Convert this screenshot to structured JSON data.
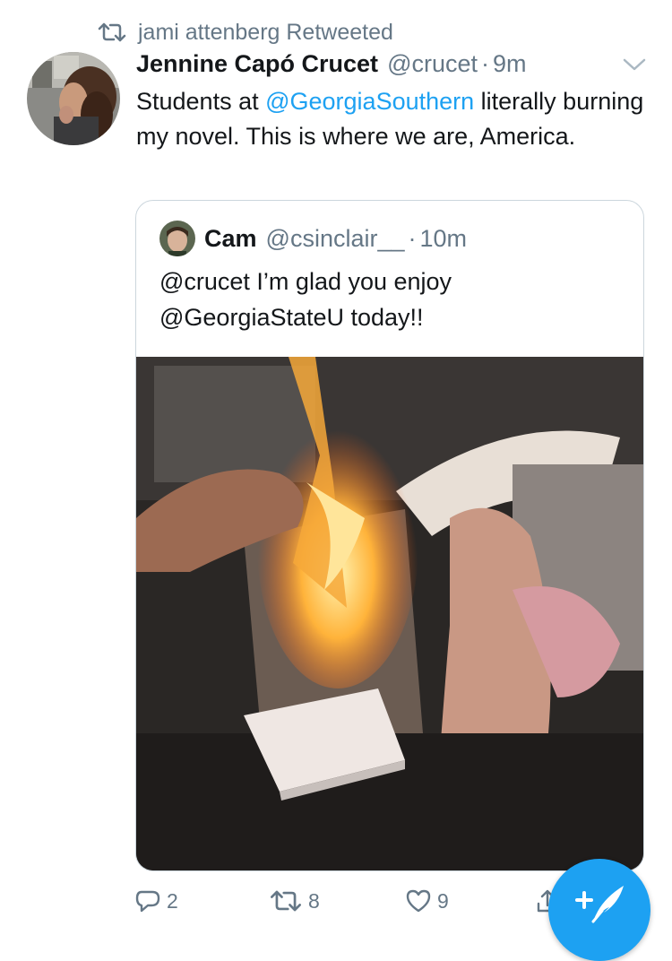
{
  "retweet": {
    "text": "jami attenberg Retweeted"
  },
  "tweet": {
    "name": "Jennine Capó Crucet",
    "handle": "@crucet",
    "dot": "·",
    "time": "9m",
    "text_before": "Students at ",
    "mention": "@GeorgiaSouthern",
    "text_after": " literally burning my novel. This is where we are, America."
  },
  "quote": {
    "name": "Cam",
    "handle": "@csinclair__",
    "dot": "·",
    "time": "10m",
    "line1": "@crucet I’m glad you enjoy",
    "line2": "@GeorgiaStateU today!!"
  },
  "actions": {
    "replies": "2",
    "retweets": "8",
    "likes": "9"
  },
  "colors": {
    "accent": "#1da1f2",
    "muted": "#657786",
    "text": "#14171a",
    "border": "#ccd6dd"
  },
  "icons": {
    "retweet": "retweet-icon",
    "chevron": "chevron-down-icon",
    "reply": "reply-icon",
    "like": "heart-icon",
    "share": "share-icon",
    "compose": "compose-tweet-icon"
  }
}
